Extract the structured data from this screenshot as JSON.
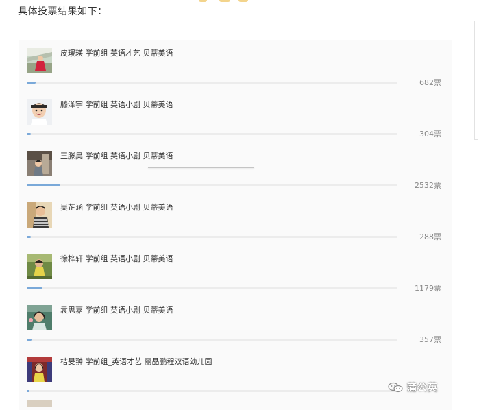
{
  "intro_text": "具体投票结果如下：",
  "accent_color": "#7aa9d9",
  "vote_max": 2532,
  "vote_items": [
    {
      "name": "皮瑷瑛 学前组 英语才艺 贝蒂美语",
      "votes": 682,
      "votes_label": "682票",
      "avatar": "child-photo-red-dress"
    },
    {
      "name": "滕泽宇 学前组 英语小剧 贝蒂美语",
      "votes": 304,
      "votes_label": "304票",
      "avatar": "child-photo-boy-white"
    },
    {
      "name": "王滕昊 学前组 英语小剧 贝蒂美语",
      "votes": 2532,
      "votes_label": "2532票",
      "avatar": "child-photo-boy-stage"
    },
    {
      "name": "吴芷涵 学前组 英语小剧 贝蒂美语",
      "votes": 288,
      "votes_label": "288票",
      "avatar": "child-photo-boy-striped"
    },
    {
      "name": "徐梓轩 学前组 英语小剧 贝蒂美语",
      "votes": 1179,
      "votes_label": "1179票",
      "avatar": "child-photo-boy-outdoor"
    },
    {
      "name": "袁思嘉 学前组 英语小剧 贝蒂美语",
      "votes": 357,
      "votes_label": "357票",
      "avatar": "child-photo-girl-green"
    },
    {
      "name": "桔旻翀 学前组_英语才艺 丽晶鹏程双语幼儿园",
      "votes": 230,
      "votes_label": "",
      "avatar": "child-photo-girl-stage"
    }
  ],
  "watermark": {
    "text": "蒲公英",
    "icon": "wechat-icon"
  }
}
